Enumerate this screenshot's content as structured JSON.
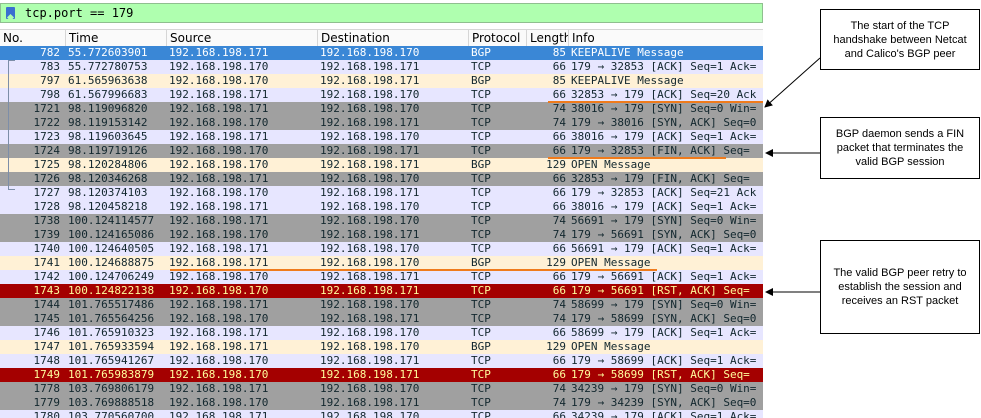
{
  "filter": {
    "text": "tcp.port == 179"
  },
  "columns": [
    "No.",
    "Time",
    "Source",
    "Destination",
    "Protocol",
    "Length",
    "Info"
  ],
  "rows": [
    {
      "no": "782",
      "time": "55.772603901",
      "src": "192.168.198.171",
      "dst": "192.168.198.170",
      "proto": "BGP",
      "len": "85",
      "info": "KEEPALIVE Message",
      "style": "sel"
    },
    {
      "no": "783",
      "time": "55.772780753",
      "src": "192.168.198.170",
      "dst": "192.168.198.171",
      "proto": "TCP",
      "len": "66",
      "info": "179 → 32853 [ACK] Seq=1 Ack=",
      "style": "tcp"
    },
    {
      "no": "797",
      "time": "61.565963638",
      "src": "192.168.198.170",
      "dst": "192.168.198.171",
      "proto": "BGP",
      "len": "85",
      "info": "KEEPALIVE Message",
      "style": "bgp"
    },
    {
      "no": "798",
      "time": "61.567996683",
      "src": "192.168.198.171",
      "dst": "192.168.198.170",
      "proto": "TCP",
      "len": "66",
      "info": "32853 → 179 [ACK] Seq=20 Ack",
      "style": "tcp"
    },
    {
      "no": "1721",
      "time": "98.119096820",
      "src": "192.168.198.171",
      "dst": "192.168.198.170",
      "proto": "TCP",
      "len": "74",
      "info": "38016 → 179 [SYN] Seq=0 Win=",
      "style": "syn"
    },
    {
      "no": "1722",
      "time": "98.119153142",
      "src": "192.168.198.170",
      "dst": "192.168.198.171",
      "proto": "TCP",
      "len": "74",
      "info": "179 → 38016 [SYN, ACK] Seq=0",
      "style": "syn"
    },
    {
      "no": "1723",
      "time": "98.119603645",
      "src": "192.168.198.171",
      "dst": "192.168.198.170",
      "proto": "TCP",
      "len": "66",
      "info": "38016 → 179 [ACK] Seq=1 Ack=",
      "style": "tcp"
    },
    {
      "no": "1724",
      "time": "98.119719126",
      "src": "192.168.198.170",
      "dst": "192.168.198.171",
      "proto": "TCP",
      "len": "66",
      "info": "179 → 32853 [FIN, ACK] Seq=",
      "style": "syn"
    },
    {
      "no": "1725",
      "time": "98.120284806",
      "src": "192.168.198.170",
      "dst": "192.168.198.171",
      "proto": "BGP",
      "len": "129",
      "info": "OPEN Message",
      "style": "bgp"
    },
    {
      "no": "1726",
      "time": "98.120346268",
      "src": "192.168.198.171",
      "dst": "192.168.198.170",
      "proto": "TCP",
      "len": "66",
      "info": "32853 → 179 [FIN, ACK] Seq=",
      "style": "syn"
    },
    {
      "no": "1727",
      "time": "98.120374103",
      "src": "192.168.198.170",
      "dst": "192.168.198.171",
      "proto": "TCP",
      "len": "66",
      "info": "179 → 32853 [ACK] Seq=21 Ack",
      "style": "tcp"
    },
    {
      "no": "1728",
      "time": "98.120458218",
      "src": "192.168.198.171",
      "dst": "192.168.198.170",
      "proto": "TCP",
      "len": "66",
      "info": "38016 → 179 [ACK] Seq=1 Ack=",
      "style": "tcp"
    },
    {
      "no": "1738",
      "time": "100.124114577",
      "src": "192.168.198.171",
      "dst": "192.168.198.170",
      "proto": "TCP",
      "len": "74",
      "info": "56691 → 179 [SYN] Seq=0 Win=",
      "style": "syn"
    },
    {
      "no": "1739",
      "time": "100.124165086",
      "src": "192.168.198.170",
      "dst": "192.168.198.171",
      "proto": "TCP",
      "len": "74",
      "info": "179 → 56691 [SYN, ACK] Seq=0",
      "style": "syn"
    },
    {
      "no": "1740",
      "time": "100.124640505",
      "src": "192.168.198.171",
      "dst": "192.168.198.170",
      "proto": "TCP",
      "len": "66",
      "info": "56691 → 179 [ACK] Seq=1 Ack=",
      "style": "tcp"
    },
    {
      "no": "1741",
      "time": "100.124688875",
      "src": "192.168.198.171",
      "dst": "192.168.198.170",
      "proto": "BGP",
      "len": "129",
      "info": "OPEN Message",
      "style": "bgp"
    },
    {
      "no": "1742",
      "time": "100.124706249",
      "src": "192.168.198.170",
      "dst": "192.168.198.171",
      "proto": "TCP",
      "len": "66",
      "info": "179 → 56691 [ACK] Seq=1 Ack=",
      "style": "tcp"
    },
    {
      "no": "1743",
      "time": "100.124822138",
      "src": "192.168.198.170",
      "dst": "192.168.198.171",
      "proto": "TCP",
      "len": "66",
      "info": "179 → 56691 [RST, ACK] Seq=",
      "style": "rst"
    },
    {
      "no": "1744",
      "time": "101.765517486",
      "src": "192.168.198.171",
      "dst": "192.168.198.170",
      "proto": "TCP",
      "len": "74",
      "info": "58699 → 179 [SYN] Seq=0 Win=",
      "style": "syn"
    },
    {
      "no": "1745",
      "time": "101.765564256",
      "src": "192.168.198.170",
      "dst": "192.168.198.171",
      "proto": "TCP",
      "len": "74",
      "info": "179 → 58699 [SYN, ACK] Seq=0",
      "style": "syn"
    },
    {
      "no": "1746",
      "time": "101.765910323",
      "src": "192.168.198.171",
      "dst": "192.168.198.170",
      "proto": "TCP",
      "len": "66",
      "info": "58699 → 179 [ACK] Seq=1 Ack=",
      "style": "tcp"
    },
    {
      "no": "1747",
      "time": "101.765933594",
      "src": "192.168.198.171",
      "dst": "192.168.198.170",
      "proto": "BGP",
      "len": "129",
      "info": "OPEN Message",
      "style": "bgp"
    },
    {
      "no": "1748",
      "time": "101.765941267",
      "src": "192.168.198.170",
      "dst": "192.168.198.171",
      "proto": "TCP",
      "len": "66",
      "info": "179 → 58699 [ACK] Seq=1 Ack=",
      "style": "tcp"
    },
    {
      "no": "1749",
      "time": "101.765983879",
      "src": "192.168.198.170",
      "dst": "192.168.198.171",
      "proto": "TCP",
      "len": "66",
      "info": "179 → 58699 [RST, ACK] Seq=",
      "style": "rst"
    },
    {
      "no": "1778",
      "time": "103.769806179",
      "src": "192.168.198.171",
      "dst": "192.168.198.170",
      "proto": "TCP",
      "len": "74",
      "info": "34239 → 179 [SYN] Seq=0 Win=",
      "style": "syn"
    },
    {
      "no": "1779",
      "time": "103.769888518",
      "src": "192.168.198.170",
      "dst": "192.168.198.171",
      "proto": "TCP",
      "len": "74",
      "info": "179 → 34239 [SYN, ACK] Seq=0",
      "style": "syn"
    },
    {
      "no": "1780",
      "time": "103.770560700",
      "src": "192.168.198.171",
      "dst": "192.168.198.170",
      "proto": "TCP",
      "len": "66",
      "info": "34239 → 179 [ACK] Seq=1 Ack=",
      "style": "tcp"
    }
  ],
  "annotations": {
    "handshake": "The start of the TCP handshake between Netcat and Calico's BGP peer",
    "fin": "BGP daemon sends a FIN packet that terminates the valid BGP session",
    "rst": "The valid BGP peer retry to establish the session and receives an RST packet"
  },
  "colors": {
    "selected": "#3a87d6",
    "bgp": "#fff1d6",
    "tcp": "#e7e6ff",
    "syn_fin": "#a0a0a0",
    "rst": "#a40000",
    "highlight_underline": "#ef7b1c",
    "filter_valid": "#afffaf"
  }
}
